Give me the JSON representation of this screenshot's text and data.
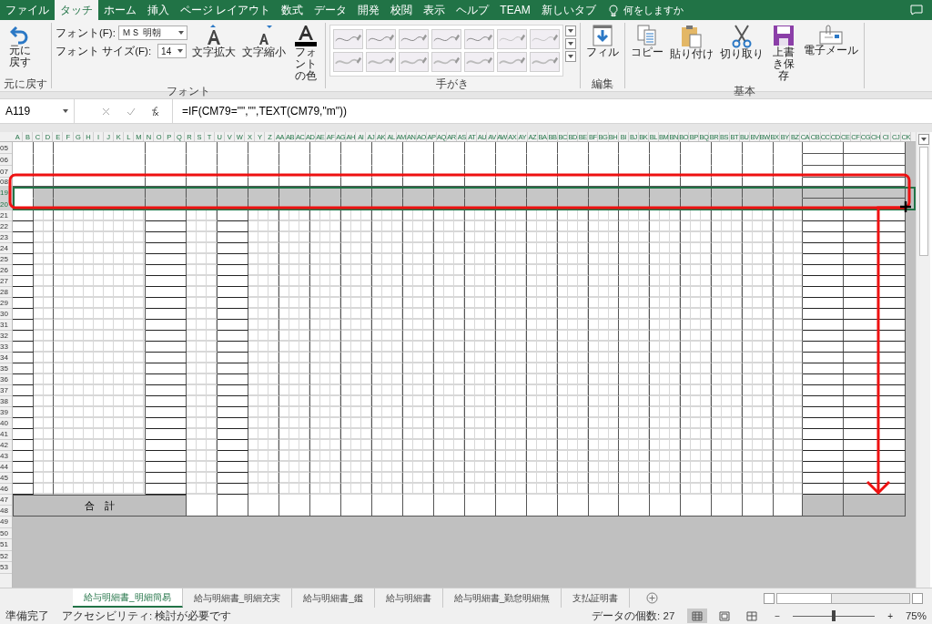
{
  "ribbon_tabs": [
    {
      "label": "ファイル",
      "selected": false
    },
    {
      "label": "タッチ",
      "selected": true
    },
    {
      "label": "ホーム",
      "selected": false
    },
    {
      "label": "挿入",
      "selected": false
    },
    {
      "label": "ページ レイアウト",
      "selected": false
    },
    {
      "label": "数式",
      "selected": false
    },
    {
      "label": "データ",
      "selected": false
    },
    {
      "label": "開発",
      "selected": false
    },
    {
      "label": "校閲",
      "selected": false
    },
    {
      "label": "表示",
      "selected": false
    },
    {
      "label": "ヘルプ",
      "selected": false
    },
    {
      "label": "TEAM",
      "selected": false
    },
    {
      "label": "新しいタブ",
      "selected": false
    }
  ],
  "tell_me": "何をしますか",
  "groups": [
    {
      "kind": "undo",
      "label": "元に戻す",
      "button": "元に戻す"
    },
    {
      "kind": "font",
      "label": "フォント",
      "font_label": "フォント(F):",
      "font_value": "ＭＳ 明朝",
      "size_label": "フォント サイズ(F):",
      "size_value": "14",
      "buttons": [
        {
          "label": "文字拡大"
        },
        {
          "label": "文字縮小"
        },
        {
          "label": "フォントの色"
        }
      ]
    },
    {
      "kind": "pens",
      "label": "手がき"
    },
    {
      "kind": "edit",
      "label": "編集",
      "buttons": [
        {
          "label": "フィル"
        }
      ]
    },
    {
      "kind": "basic",
      "label": "基本",
      "buttons": [
        {
          "label": "コピー"
        },
        {
          "label": "貼り付け"
        },
        {
          "label": "切り取り"
        },
        {
          "label": "上書き保存"
        },
        {
          "label": "電子メール"
        }
      ]
    }
  ],
  "name_box": "A119",
  "formula": "=IF(CM79=\"\",\"\",TEXT(CM79,\"m\"))",
  "columns": [
    "A",
    "B",
    "C",
    "D",
    "E",
    "F",
    "G",
    "H",
    "I",
    "J",
    "K",
    "L",
    "M",
    "N",
    "O",
    "P",
    "Q",
    "R",
    "S",
    "T",
    "U",
    "V",
    "W",
    "X",
    "Y",
    "Z",
    "AA",
    "AB",
    "AC",
    "AD",
    "AE",
    "AF",
    "AG",
    "AH",
    "AI",
    "AJ",
    "AK",
    "AL",
    "AM",
    "AN",
    "AO",
    "AP",
    "AQ",
    "AR",
    "AS",
    "AT",
    "AU",
    "AV",
    "AW",
    "AX",
    "AY",
    "AZ",
    "BA",
    "BB",
    "BC",
    "BD",
    "BE",
    "BF",
    "BG",
    "BH",
    "BI",
    "BJ",
    "BK",
    "BL",
    "BM",
    "BN",
    "BO",
    "BP",
    "BQ",
    "BR",
    "BS",
    "BT",
    "BU",
    "BV",
    "BW",
    "BX",
    "BY",
    "BZ",
    "CA",
    "CB",
    "CC",
    "CD",
    "CE",
    "CF",
    "CG",
    "CH",
    "CI",
    "CJ",
    "CK"
  ],
  "rows": [
    {
      "label": "05",
      "kind": "form",
      "selected": false
    },
    {
      "label": "06",
      "kind": "form",
      "selected": false
    },
    {
      "label": "07",
      "kind": "form",
      "selected": false
    },
    {
      "label": "08",
      "kind": "gap",
      "selected": false
    },
    {
      "label": "19",
      "kind": "band",
      "selected": true
    },
    {
      "label": "20",
      "kind": "band",
      "selected": true
    },
    {
      "label": "21",
      "kind": "grid",
      "selected": false
    },
    {
      "label": "22",
      "kind": "grid",
      "selected": false
    },
    {
      "label": "23",
      "kind": "grid",
      "selected": false
    },
    {
      "label": "24",
      "kind": "grid",
      "selected": false
    },
    {
      "label": "25",
      "kind": "grid",
      "selected": false
    },
    {
      "label": "26",
      "kind": "grid",
      "selected": false
    },
    {
      "label": "27",
      "kind": "grid",
      "selected": false
    },
    {
      "label": "28",
      "kind": "grid",
      "selected": false
    },
    {
      "label": "29",
      "kind": "grid",
      "selected": false
    },
    {
      "label": "30",
      "kind": "grid",
      "selected": false
    },
    {
      "label": "31",
      "kind": "grid",
      "selected": false
    },
    {
      "label": "32",
      "kind": "grid",
      "selected": false
    },
    {
      "label": "33",
      "kind": "grid",
      "selected": false
    },
    {
      "label": "34",
      "kind": "grid",
      "selected": false
    },
    {
      "label": "35",
      "kind": "grid",
      "selected": false
    },
    {
      "label": "36",
      "kind": "grid",
      "selected": false
    },
    {
      "label": "37",
      "kind": "grid",
      "selected": false
    },
    {
      "label": "38",
      "kind": "grid",
      "selected": false
    },
    {
      "label": "39",
      "kind": "grid",
      "selected": false
    },
    {
      "label": "40",
      "kind": "grid",
      "selected": false
    },
    {
      "label": "41",
      "kind": "grid",
      "selected": false
    },
    {
      "label": "42",
      "kind": "grid",
      "selected": false
    },
    {
      "label": "43",
      "kind": "grid",
      "selected": false
    },
    {
      "label": "44",
      "kind": "grid",
      "selected": false
    },
    {
      "label": "45",
      "kind": "grid",
      "selected": false
    },
    {
      "label": "46",
      "kind": "grid",
      "selected": false
    },
    {
      "label": "47",
      "kind": "total",
      "selected": false
    },
    {
      "label": "48",
      "kind": "total",
      "selected": false
    },
    {
      "label": "49",
      "kind": "empty",
      "selected": false
    },
    {
      "label": "50",
      "kind": "empty",
      "selected": false
    },
    {
      "label": "51",
      "kind": "empty",
      "selected": false
    },
    {
      "label": "52",
      "kind": "empty",
      "selected": false
    },
    {
      "label": "53",
      "kind": "empty",
      "selected": false
    }
  ],
  "total_label": "合　計",
  "sheet_tabs": [
    {
      "label": "給与明細書_明細簡易",
      "selected": true
    },
    {
      "label": "給与明細書_明細充実",
      "selected": false
    },
    {
      "label": "給与明細書_鑑",
      "selected": false
    },
    {
      "label": "給与明細書",
      "selected": false
    },
    {
      "label": "給与明細書_勤怠明細無",
      "selected": false
    },
    {
      "label": "支払証明書",
      "selected": false
    }
  ],
  "status": {
    "ready": "準備完了",
    "accessibility": "アクセシビリティ: 検討が必要です",
    "count": "データの個数: 27",
    "views": [
      {
        "kind": "normal",
        "selected": true
      },
      {
        "kind": "layout",
        "selected": false
      },
      {
        "kind": "preview",
        "selected": false
      }
    ],
    "zoom_out": "−",
    "zoom_in": "+",
    "zoom": {
      "level": 0.5
    },
    "zoom_reading": "75%"
  }
}
